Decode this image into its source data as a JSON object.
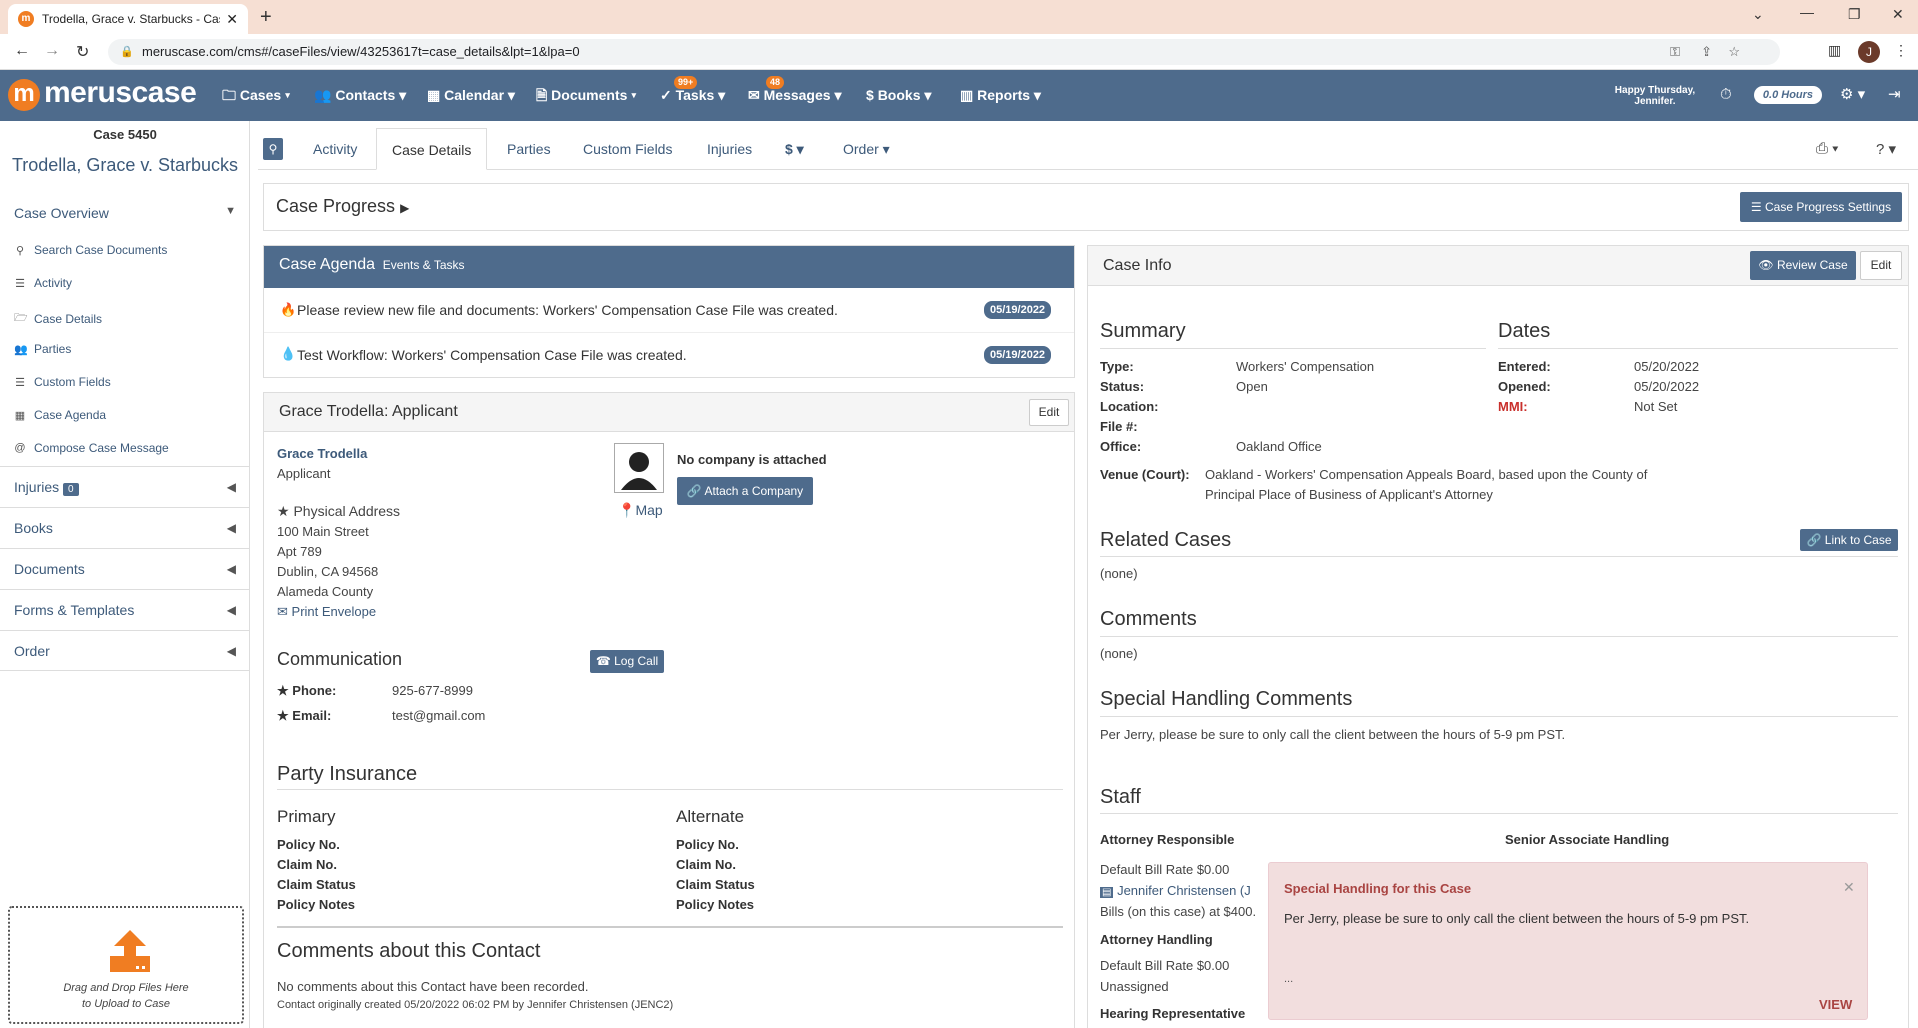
{
  "browser": {
    "tab_title": "Trodella, Grace v. Starbucks - Cas",
    "url": "meruscase.com/cms#/caseFiles/view/43253617t=case_details&lpt=1&lpa=0",
    "profile_initial": "J"
  },
  "nav": {
    "logo": "meruscase",
    "items": [
      {
        "label": "Cases"
      },
      {
        "label": "Contacts"
      },
      {
        "label": "Calendar"
      },
      {
        "label": "Documents"
      },
      {
        "label": "Tasks",
        "badge": "99+"
      },
      {
        "label": "Messages",
        "badge": "48"
      },
      {
        "label": "Books"
      },
      {
        "label": "Reports"
      }
    ],
    "greeting_1": "Happy Thursday,",
    "greeting_2": "Jennifer.",
    "hours": "0.0 Hours"
  },
  "case": {
    "number": "Case 5450",
    "title": "Trodella, Grace v. Starbucks"
  },
  "sidebar": {
    "overview": "Case Overview",
    "items": [
      {
        "label": "Search Case Documents"
      },
      {
        "label": "Activity"
      },
      {
        "label": "Case Details"
      },
      {
        "label": "Parties"
      },
      {
        "label": "Custom Fields"
      },
      {
        "label": "Case Agenda"
      },
      {
        "label": "Compose Case Message"
      }
    ],
    "sections": [
      {
        "label": "Injuries",
        "badge": "0"
      },
      {
        "label": "Books"
      },
      {
        "label": "Documents"
      },
      {
        "label": "Forms & Templates"
      },
      {
        "label": "Order"
      }
    ],
    "upload_1": "Drag and Drop Files Here",
    "upload_2": "to Upload to Case"
  },
  "tabs": [
    "Activity",
    "Case Details",
    "Parties",
    "Custom Fields",
    "Injuries",
    "$",
    "Order"
  ],
  "progress": {
    "title": "Case Progress",
    "settings_button": "Case Progress Settings"
  },
  "agenda": {
    "title": "Case Agenda",
    "subtitle": "Events & Tasks",
    "items": [
      {
        "text": "Please review new file and documents: Workers' Compensation Case File was created.",
        "date": "05/19/2022"
      },
      {
        "text": "Test Workflow: Workers' Compensation Case File was created.",
        "date": "05/19/2022"
      }
    ]
  },
  "applicant": {
    "header": "Grace Trodella: Applicant",
    "edit": "Edit",
    "name": "Grace Trodella",
    "role": "Applicant",
    "address_label": "Physical Address",
    "address": [
      "100 Main Street",
      "Apt 789",
      "Dublin, CA 94568",
      "Alameda County"
    ],
    "print_envelope": "Print Envelope",
    "map": "Map",
    "no_company": "No company is attached",
    "attach_company": "Attach a Company",
    "communication": "Communication",
    "log_call": "Log Call",
    "phone_label": "Phone:",
    "phone": "925-677-8999",
    "email_label": "Email:",
    "email": "test@gmail.com",
    "insurance_title": "Party Insurance",
    "primary": "Primary",
    "alternate": "Alternate",
    "ins_fields": [
      "Policy No.",
      "Claim No.",
      "Claim Status",
      "Policy Notes"
    ],
    "comments_title": "Comments about this Contact",
    "no_comments": "No comments about this Contact have been recorded.",
    "created": "Contact originally created 05/20/2022 06:02 PM by Jennifer Christensen (JENC2)"
  },
  "info": {
    "title": "Case Info",
    "review": "Review Case",
    "edit": "Edit",
    "summary": "Summary",
    "dates": "Dates",
    "type_label": "Type:",
    "type": "Workers' Compensation",
    "status_label": "Status:",
    "status": "Open",
    "location_label": "Location:",
    "file_label": "File #:",
    "office_label": "Office:",
    "office": "Oakland Office",
    "venue_label": "Venue (Court):",
    "venue_1": "Oakland - Workers' Compensation Appeals Board, based upon the County of",
    "venue_2": "Principal Place of Business of Applicant's Attorney",
    "entered_label": "Entered:",
    "entered": "05/20/2022",
    "opened_label": "Opened:",
    "opened": "05/20/2022",
    "mmi_label": "MMI:",
    "mmi": "Not Set",
    "related": "Related Cases",
    "link_case": "Link to Case",
    "none": "(none)",
    "comments": "Comments",
    "special": "Special Handling Comments",
    "special_text": "Per Jerry, please be sure to only call the client between the hours of 5-9 pm PST.",
    "staff": "Staff",
    "atty_resp": "Attorney Responsible",
    "senior": "Senior Associate Handling",
    "bill_rate": "Default Bill Rate $0.00",
    "staff_name": "Jennifer Christensen (J",
    "bills": "Bills (on this case) at $400.",
    "atty_handling": "Attorney Handling",
    "unassigned": "Unassigned",
    "hearing": "Hearing Representative"
  },
  "toast": {
    "title": "Special Handling for this Case",
    "text": "Per Jerry, please be sure to only call the client between the hours of 5-9 pm PST.",
    "ellipsis": "...",
    "view": "VIEW"
  },
  "colors": {
    "nav": "#4e6b8c",
    "accent": "#f07d22",
    "toast_bg": "#f2dede",
    "toast_text": "#a94442"
  }
}
